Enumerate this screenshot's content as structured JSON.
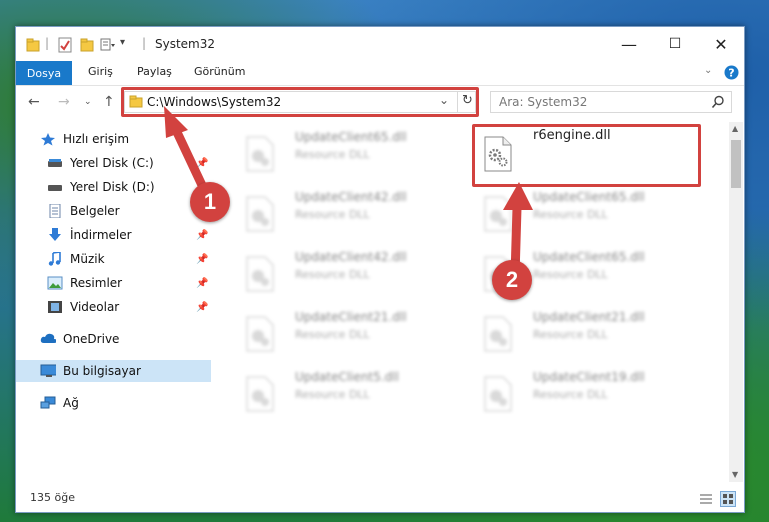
{
  "window": {
    "title": "System32",
    "controls": {
      "minimize": "—",
      "maximize": "☐",
      "close": "✕"
    }
  },
  "ribbon": {
    "tabs": [
      {
        "label": "Dosya"
      },
      {
        "label": "Giriş"
      },
      {
        "label": "Paylaş"
      },
      {
        "label": "Görünüm"
      }
    ]
  },
  "address": {
    "path": "C:\\Windows\\System32",
    "search_placeholder": "Ara: System32"
  },
  "sidebar": {
    "items": [
      {
        "label": "Hızlı erişim",
        "icon": "star-icon"
      },
      {
        "label": "Yerel Disk (C:)",
        "icon": "drive-icon"
      },
      {
        "label": "Yerel Disk (D:)",
        "icon": "drive-icon"
      },
      {
        "label": "Belgeler",
        "icon": "documents-icon"
      },
      {
        "label": "İndirmeler",
        "icon": "download-icon"
      },
      {
        "label": "Müzik",
        "icon": "music-icon"
      },
      {
        "label": "Resimler",
        "icon": "pictures-icon"
      },
      {
        "label": "Videolar",
        "icon": "videos-icon"
      },
      {
        "label": "OneDrive",
        "icon": "cloud-icon"
      },
      {
        "label": "Bu bilgisayar",
        "icon": "computer-icon"
      },
      {
        "label": "Ağ",
        "icon": "network-icon"
      }
    ]
  },
  "files": {
    "highlighted": {
      "name": "r6engine.dll"
    },
    "items": [
      {
        "name": "UpdateClient65.dll",
        "desc": "Resource DLL"
      },
      {
        "name": "UpdateClient42.dll",
        "desc": "Resource DLL"
      },
      {
        "name": "UpdateClient65.dll",
        "desc": "Resource DLL"
      },
      {
        "name": "UpdateClient42.dll",
        "desc": "Resource DLL"
      },
      {
        "name": "UpdateClient65.dll",
        "desc": "Resource DLL"
      },
      {
        "name": "UpdateClient21.dll",
        "desc": "Resource DLL"
      },
      {
        "name": "UpdateClient21.dll",
        "desc": "Resource DLL"
      },
      {
        "name": "UpdateClient5.dll",
        "desc": "Resource DLL"
      },
      {
        "name": "UpdateClient19.dll",
        "desc": "Resource DLL"
      }
    ]
  },
  "status": {
    "count": "135 öğe"
  },
  "annotations": {
    "badge1": "1",
    "badge2": "2",
    "color": "#d2423f"
  }
}
